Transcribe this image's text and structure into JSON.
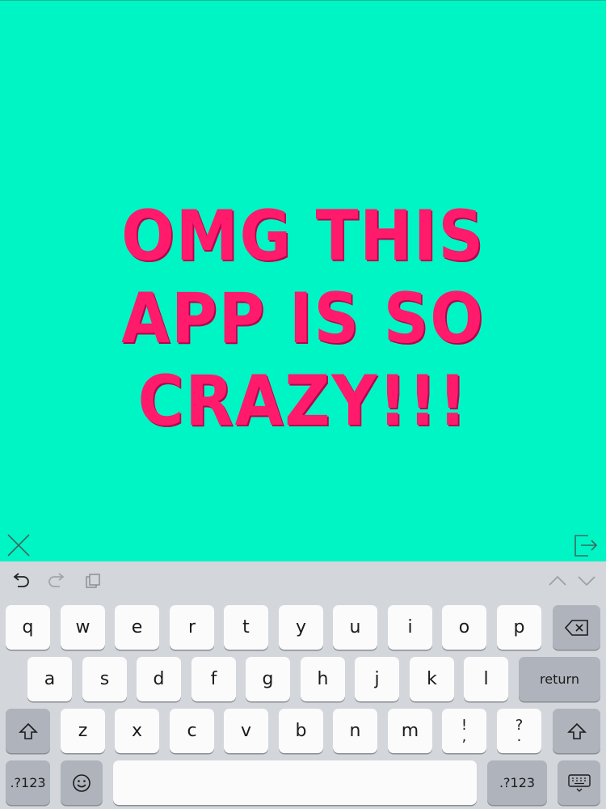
{
  "canvas": {
    "text": "OMG THIS APP IS SO CRAZY!!!",
    "background": "#00f5c4",
    "text_color": "#ff1a6c"
  },
  "controls": {
    "close_icon": "close-icon",
    "export_icon": "export-icon"
  },
  "keyboard": {
    "toolbar": [
      "undo-icon",
      "redo-icon",
      "paste-icon",
      "chevron-up-icon",
      "chevron-down-icon"
    ],
    "row1": [
      "q",
      "w",
      "e",
      "r",
      "t",
      "y",
      "u",
      "i",
      "o",
      "p"
    ],
    "row2": [
      "a",
      "s",
      "d",
      "f",
      "g",
      "h",
      "j",
      "k",
      "l"
    ],
    "row3": [
      "z",
      "x",
      "c",
      "v",
      "b",
      "n",
      "m"
    ],
    "punct1_top": "!",
    "punct1_bottom": ",",
    "punct2_top": "?",
    "punct2_bottom": ".",
    "return_label": "return",
    "num_label_left": ".?123",
    "num_label_right": ".?123"
  }
}
